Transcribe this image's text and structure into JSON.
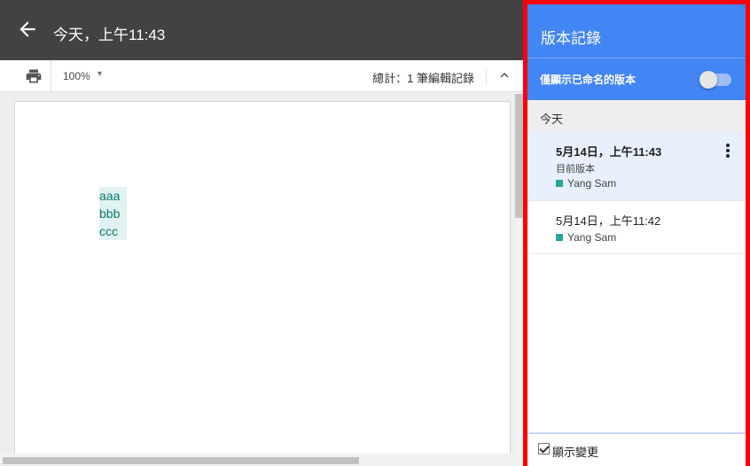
{
  "header": {
    "title": "今天，上午11:43",
    "back_icon": "arrow-back-icon"
  },
  "toolbar": {
    "print_icon": "print-icon",
    "zoom": "100%",
    "total_edits": "總計：1 筆編輯記錄",
    "collapse_icon": "chevron-up-icon"
  },
  "document": {
    "lines": [
      "aaa",
      "bbb",
      "ccc"
    ],
    "highlight_color": "#e0f2f1",
    "text_color": "#0b7a6e"
  },
  "panel": {
    "title": "版本記錄",
    "filter_label": "僅顯示已命名的版本",
    "filter_on": false,
    "accent": "#4285f4",
    "group_label": "今天",
    "versions": [
      {
        "date": "5月14日，上午11:43",
        "subtitle": "目前版本",
        "user": "Yang Sam",
        "selected": true
      },
      {
        "date": "5月14日，上午11:42",
        "subtitle": "",
        "user": "Yang Sam",
        "selected": false
      }
    ],
    "user_color": "#26a69a",
    "show_changes_label": "顯示變更",
    "show_changes_checked": true
  },
  "highlight_border_color": "#ff0000"
}
